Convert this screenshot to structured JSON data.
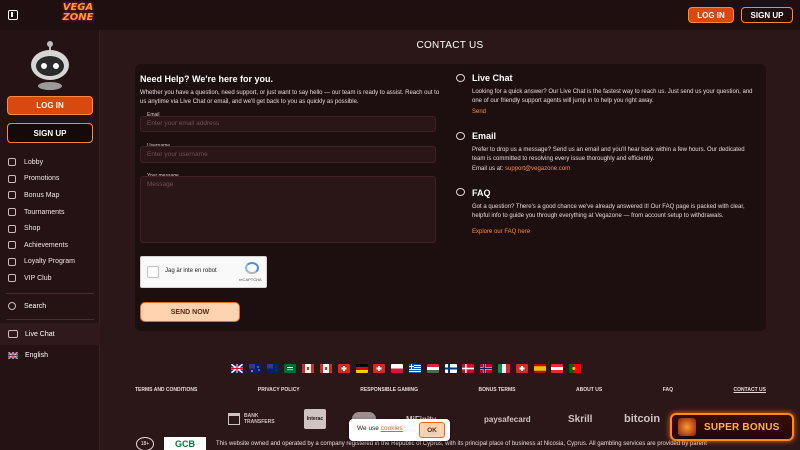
{
  "header": {
    "logo_text": "VEGA\nZONE",
    "login_label": "LOG IN",
    "signup_label": "SIGN UP"
  },
  "sidebar": {
    "login_label": "LOG IN",
    "signup_label": "SIGN UP",
    "items": [
      {
        "label": "Lobby",
        "icon": "dice-icon"
      },
      {
        "label": "Promotions",
        "icon": "megaphone-icon"
      },
      {
        "label": "Bonus Map",
        "icon": "map-icon"
      },
      {
        "label": "Tournaments",
        "icon": "trophy-icon"
      },
      {
        "label": "Shop",
        "icon": "shop-icon"
      },
      {
        "label": "Achievements",
        "icon": "achievement-icon"
      },
      {
        "label": "Loyalty Program",
        "icon": "loyalty-icon"
      },
      {
        "label": "VIP Club",
        "icon": "vip-icon"
      }
    ],
    "search_label": "Search",
    "live_chat_label": "Live Chat",
    "language_label": "English"
  },
  "main": {
    "title": "CONTACT US",
    "help_title": "Need Help? We're here for you.",
    "help_desc": "Whether you have a question, need support, or just want to say hello — our team is ready to assist. Reach out to us anytime via Live Chat or email, and we'll get back to you as quickly as possible.",
    "form": {
      "email_label": "Email",
      "email_placeholder": "Enter your email address",
      "username_label": "Username",
      "username_placeholder": "Enter your username",
      "message_label": "Your message",
      "message_placeholder": "Message",
      "captcha_label": "Jag är inte en robot",
      "captcha_brand": "reCAPTCHA",
      "send_label": "SEND NOW"
    },
    "sections": {
      "live_chat": {
        "title": "Live Chat",
        "desc": "Looking for a quick answer? Our Live Chat is the fastest way to reach us. Just send us your question, and one of our friendly support agents will jump in to help you right away.",
        "link": "Send"
      },
      "email": {
        "title": "Email",
        "desc": "Prefer to drop us a message? Send us an email and you'll hear back within a few hours. Our dedicated team is committed to resolving every issue thoroughly and efficiently.",
        "email_prefix": "Email us at: ",
        "email_address": "support@vegazone.com"
      },
      "faq": {
        "title": "FAQ",
        "desc": "Got a question? There's a good chance we've already answered it! Our FAQ page is packed with clear, helpful info to guide you through everything at Vegazone — from account setup to withdrawals.",
        "link": "Explore our FAQ here"
      }
    }
  },
  "footer": {
    "links": [
      "TERMS AND CONDITIONS",
      "PRIVACY POLICY",
      "RESPONSIBLE GAMING",
      "BONUS TERMS",
      "ABOUT US",
      "FAQ",
      "CONTACT US"
    ],
    "payments": [
      "BANK TRANSFERS",
      "Interac",
      "MiFinity",
      "paysafecard",
      "Skrill",
      "bitcoin"
    ],
    "age_badge": "18+",
    "gcb": "GCB",
    "legal": "This website owned and operated by a company registered in the Republic of Cyprus, with its principal place of business at Nicosia, Cyprus. All gambling services are provided by parent"
  },
  "cookie": {
    "text": "We use ",
    "link": "cookies",
    "ok_label": "OK"
  },
  "super_bonus": {
    "label": "SUPER BONUS"
  },
  "colors": {
    "accent": "#ff8a3d",
    "button_fill": "#d9480f",
    "background": "#2b1618",
    "card": "#1d0f10"
  }
}
